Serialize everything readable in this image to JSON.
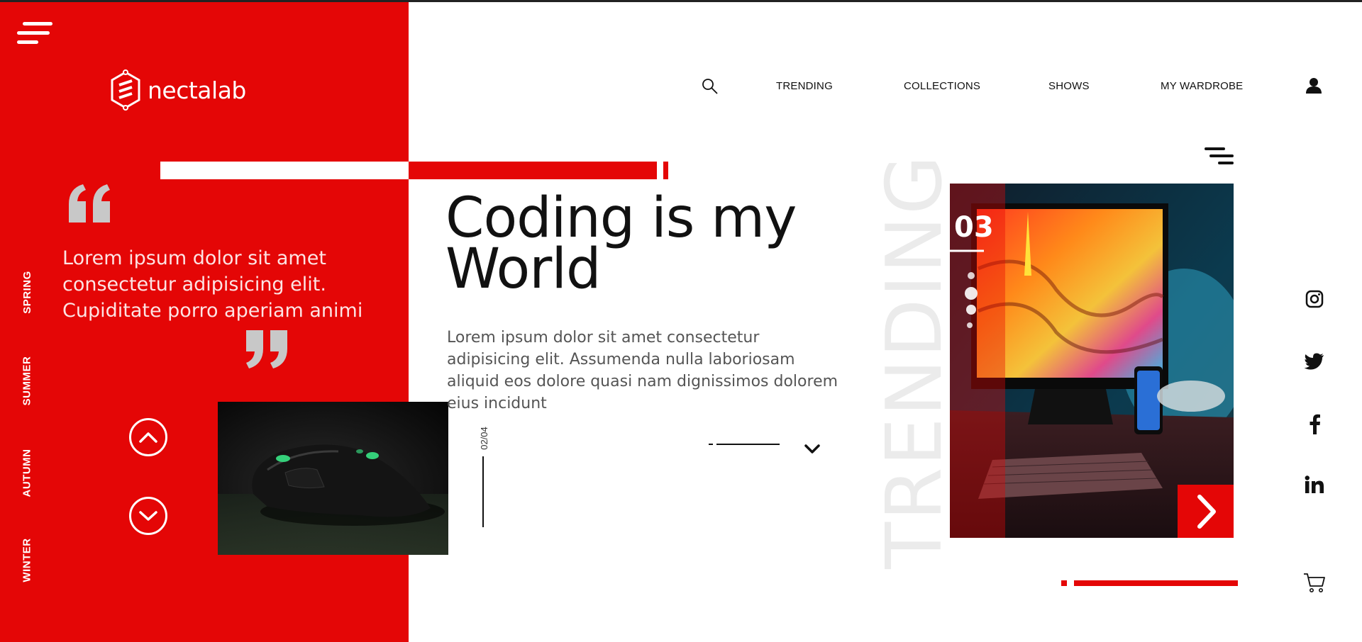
{
  "colors": {
    "accent": "#e40606",
    "panel_text": "#ffffff",
    "quote_mark": "#c8c8c8",
    "trending_text": "#ebebeb"
  },
  "menu": {
    "icon": "hamburger-menu-icon"
  },
  "brand": {
    "name": "nectalab",
    "icon": "nectalab-logo-icon"
  },
  "seasons": [
    "SPRING",
    "SUMMER",
    "AUTUMN",
    "WINTER"
  ],
  "nav": {
    "search_icon": "search-icon",
    "items": [
      "TRENDING",
      "COLLECTIONS",
      "SHOWS",
      "MY WARDROBE"
    ],
    "user_icon": "user-icon"
  },
  "quote": {
    "text": "Lorem ipsum dolor sit amet consectetur adipisicing elit. Cupiditate porro aperiam animi"
  },
  "hero": {
    "title": "Coding is my World",
    "body": "Lorem ipsum dolor sit amet consectetur adipisicing elit. Assumenda nulla laboriosam aliquid eos dolore quasi nam dignissimos dolorem eius incidunt",
    "pager": "02/04"
  },
  "trending": {
    "label": "TRENDING",
    "number": "03",
    "next_icon": "chevron-right-icon"
  },
  "social": [
    "instagram-icon",
    "twitter-icon",
    "facebook-icon",
    "linkedin-icon"
  ],
  "cart_icon": "cart-icon"
}
